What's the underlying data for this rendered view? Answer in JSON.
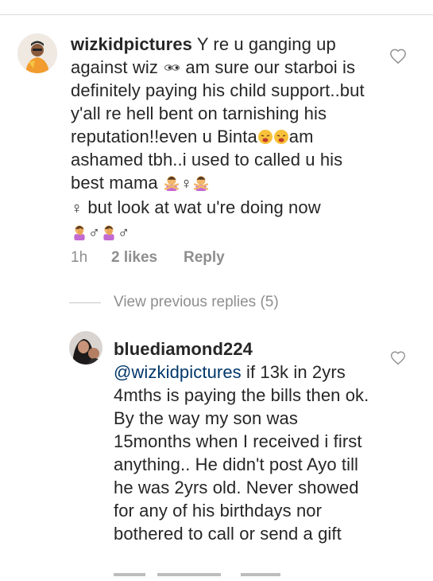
{
  "comment1": {
    "username": "wizkidpictures",
    "text_1": " Y re u ganging up against wiz ",
    "eyes_icon": "eyes-icon",
    "text_2": " am sure our starboi is definitely paying his child support..but y'all re hell bent on tarnishing his reputation!!even u Binta",
    "text_3": "am ashamed tbh..i used to called u his best mama ",
    "female_sign": "♀",
    "text_4": " but look at wat u're doing now ",
    "male_sign": "♂",
    "time": "1h",
    "likes": "2 likes",
    "reply": "Reply"
  },
  "view_previous": "View previous replies (5)",
  "comment2": {
    "username": "bluediamond224",
    "mention": "@wizkidpictures",
    "text": " if 13k in 2yrs 4mths is paying the bills then ok. By the way my son was 15months when I received i first anything.. He didn't post Ayo till he was 2yrs old. Never showed for any of his birthdays nor bothered to call or send a gift"
  },
  "colors": {
    "username": "#262626",
    "mention": "#00376b",
    "meta": "#8e8e8e",
    "emoji_face": "#f7c13a"
  }
}
